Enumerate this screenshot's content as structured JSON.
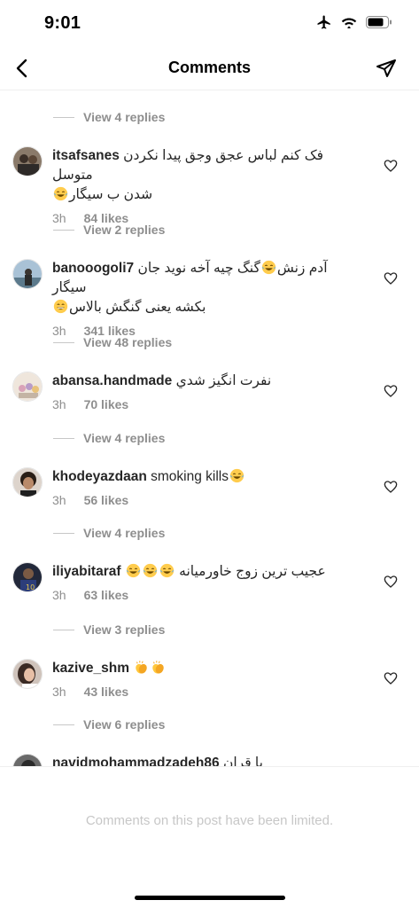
{
  "status_bar": {
    "time": "9:01",
    "icons": [
      "airplane-icon",
      "wifi-icon",
      "battery-icon"
    ]
  },
  "nav": {
    "title": "Comments",
    "back_icon": "chevron-left-icon",
    "send_icon": "paper-plane-icon"
  },
  "replies": [
    {
      "label": "View 4 replies"
    },
    {
      "label": "View 2 replies"
    },
    {
      "label": "View 48 replies"
    },
    {
      "label": "View 4 replies"
    },
    {
      "label": "View 4 replies"
    },
    {
      "label": "View 3 replies"
    },
    {
      "label": "View 6 replies"
    }
  ],
  "comments": [
    {
      "username": "itsafsanes",
      "line1": "فک کنم لباس عجق وجق پیدا نکردن متوسل",
      "line2": "شدن ب سیگار",
      "time": "3h",
      "likes": "84 likes"
    },
    {
      "username": "banooogoli7",
      "line1": "گنگ چیه آخه نوید جان",
      "line1b": "آدم زنش سیگار",
      "line2": "بکشه یعنی گنگش بالاس",
      "time": "3h",
      "likes": "341 likes"
    },
    {
      "username": "abansa.handmade",
      "line1": "نفرت انگیز شدي",
      "time": "3h",
      "likes": "70 likes"
    },
    {
      "username": "khodeyazdaan",
      "line1": "smoking kills",
      "time": "3h",
      "likes": "56 likes"
    },
    {
      "username": "iliyabitaraf",
      "line1": "عجیب ترین زوج خاورمیانه",
      "time": "3h",
      "likes": "63 likes"
    },
    {
      "username": "kazive_shm",
      "time": "3h",
      "likes": "43 likes"
    },
    {
      "username": "navidmohammadzadeh86",
      "line1": "با قران"
    }
  ],
  "footer": {
    "limited_text": "Comments on this post have been limited."
  },
  "colors": {
    "text": "#262626",
    "secondary": "#8e8e8e",
    "muted": "#c7c7c7",
    "divider": "#efefef"
  }
}
